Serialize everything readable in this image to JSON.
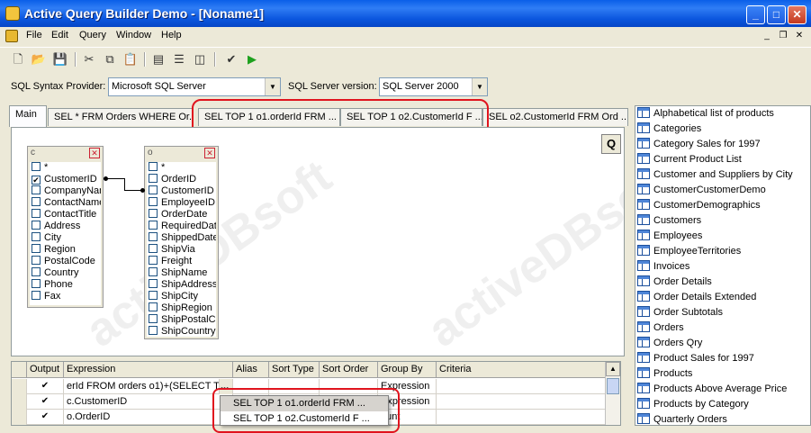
{
  "window": {
    "title": "Active Query Builder Demo - [Noname1]"
  },
  "caption_buttons": {
    "minimize": "_",
    "maximize": "□",
    "close": "✕"
  },
  "menu": {
    "items": [
      "File",
      "Edit",
      "Query",
      "Window",
      "Help"
    ]
  },
  "mdi_buttons": {
    "minimize": "_",
    "restore": "❐",
    "close": "✕"
  },
  "toolbar": {
    "new": "🗋",
    "open": "📂",
    "save": "💾",
    "cut": "✂",
    "copy": "⧉",
    "paste": "📋",
    "layout1": "▤",
    "layout2": "☰",
    "layout3": "◫",
    "check": "✔",
    "run": "▶"
  },
  "options": {
    "syntax_label": "SQL Syntax Provider:",
    "syntax_value": "Microsoft SQL Server",
    "version_label": "SQL Server version:",
    "version_value": "SQL Server 2000"
  },
  "tabs": [
    "Main",
    "SEL * FRM Orders WHERE Or...",
    "SEL TOP 1 o1.orderId FRM ...",
    "SEL TOP 1 o2.CustomerId F ...",
    "SEL o2.CustomerId FRM Ord ..."
  ],
  "canvas": {
    "q_button": "Q",
    "watermark": "activeDBsoft"
  },
  "datasource_c": {
    "alias": "c",
    "close": "✕",
    "fields": [
      {
        "name": "*",
        "checked": false
      },
      {
        "name": "CustomerID",
        "checked": true
      },
      {
        "name": "CompanyName",
        "checked": false
      },
      {
        "name": "ContactName",
        "checked": false
      },
      {
        "name": "ContactTitle",
        "checked": false
      },
      {
        "name": "Address",
        "checked": false
      },
      {
        "name": "City",
        "checked": false
      },
      {
        "name": "Region",
        "checked": false
      },
      {
        "name": "PostalCode",
        "checked": false
      },
      {
        "name": "Country",
        "checked": false
      },
      {
        "name": "Phone",
        "checked": false
      },
      {
        "name": "Fax",
        "checked": false
      }
    ]
  },
  "datasource_o": {
    "alias": "o",
    "close": "✕",
    "fields": [
      {
        "name": "*",
        "checked": false
      },
      {
        "name": "OrderID",
        "checked": false
      },
      {
        "name": "CustomerID",
        "checked": false
      },
      {
        "name": "EmployeeID",
        "checked": false
      },
      {
        "name": "OrderDate",
        "checked": false
      },
      {
        "name": "RequiredDate",
        "checked": false
      },
      {
        "name": "ShippedDate",
        "checked": false
      },
      {
        "name": "ShipVia",
        "checked": false
      },
      {
        "name": "Freight",
        "checked": false
      },
      {
        "name": "ShipName",
        "checked": false
      },
      {
        "name": "ShipAddress",
        "checked": false
      },
      {
        "name": "ShipCity",
        "checked": false
      },
      {
        "name": "ShipRegion",
        "checked": false
      },
      {
        "name": "ShipPostalCode",
        "checked": false
      },
      {
        "name": "ShipCountry",
        "checked": false
      }
    ]
  },
  "grid": {
    "columns": [
      "Output",
      "Expression",
      "Alias",
      "Sort Type",
      "Sort Order",
      "Group By",
      "Criteria"
    ],
    "rows": [
      {
        "output": "✔",
        "expression": "erId FROM orders o1)+(SELECT TO",
        "ellipsis": "...",
        "alias": "",
        "sort_type": "",
        "sort_order": "",
        "group_by": "Expression",
        "criteria": ""
      },
      {
        "output": "✔",
        "expression": "c.CustomerID",
        "ellipsis": "",
        "alias": "",
        "sort_type": "",
        "sort_order": "",
        "group_by": "Expression",
        "criteria": ""
      },
      {
        "output": "✔",
        "expression": "o.OrderID",
        "ellipsis": "",
        "alias": "",
        "sort_type": "",
        "sort_order": "",
        "group_by": "ount",
        "criteria": ""
      }
    ],
    "scroll_up": "▲"
  },
  "popup": {
    "items": [
      "SEL TOP 1 o1.orderId FRM  ...",
      "SEL TOP 1 o2.CustomerId F ..."
    ]
  },
  "objects": [
    "Alphabetical list of products",
    "Categories",
    "Category Sales for 1997",
    "Current Product List",
    "Customer and Suppliers by City",
    "CustomerCustomerDemo",
    "CustomerDemographics",
    "Customers",
    "Employees",
    "EmployeeTerritories",
    "Invoices",
    "Order Details",
    "Order Details Extended",
    "Order Subtotals",
    "Orders",
    "Orders Qry",
    "Product Sales for 1997",
    "Products",
    "Products Above Average Price",
    "Products by Category",
    "Quarterly Orders"
  ],
  "colors": {
    "titlebar": "#0a5fe8",
    "highlight": "#e0141e",
    "face": "#ece9d8"
  }
}
